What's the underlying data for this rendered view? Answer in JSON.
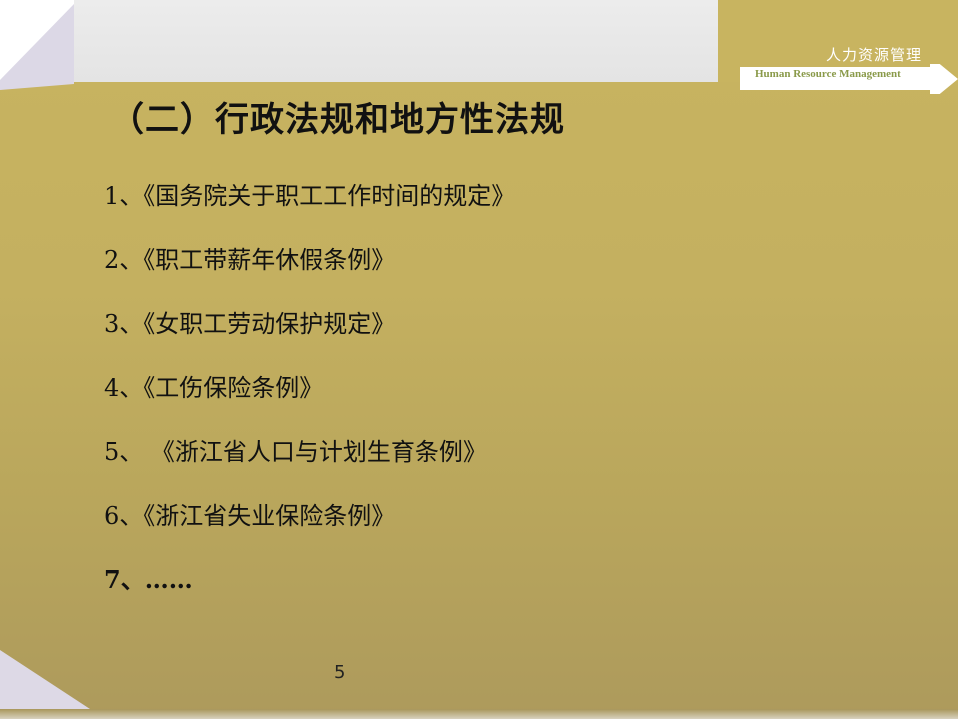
{
  "brand": {
    "cn": "人力资源管理",
    "en": "Human Resource Management"
  },
  "title": "（二）行政法规和地方性法规",
  "items": [
    "1、《国务院关于职工工作时间的规定》",
    "2、《职工带薪年休假条例》",
    "3、《女职工劳动保护规定》",
    "4、《工伤保险条例》",
    "5、 《浙江省人口与计划生育条例》",
    "6、《浙江省失业保险条例》",
    "7、……"
  ],
  "page_number": "5",
  "colors": {
    "background": "#c8b460",
    "header": "#e8e8e8",
    "text": "#111111",
    "brand_en": "#8a9a4a"
  }
}
